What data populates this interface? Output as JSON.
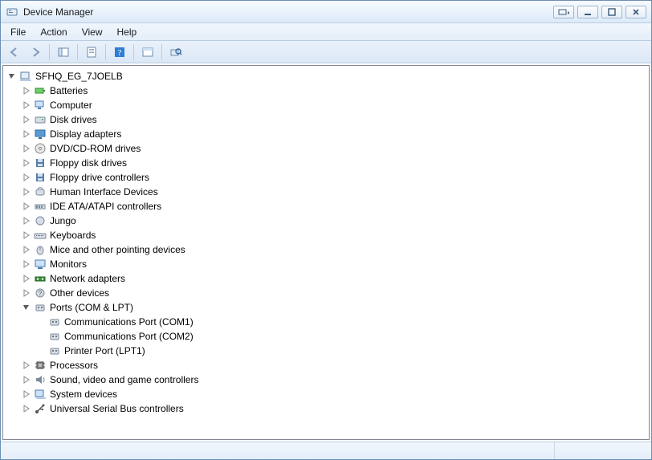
{
  "window": {
    "title": "Device Manager"
  },
  "menu": {
    "file": "File",
    "action": "Action",
    "view": "View",
    "help": "Help"
  },
  "tree": {
    "root": "SFHQ_EG_7JOELB",
    "categories": [
      {
        "label": "Batteries",
        "icon": "battery"
      },
      {
        "label": "Computer",
        "icon": "computer"
      },
      {
        "label": "Disk drives",
        "icon": "disk"
      },
      {
        "label": "Display adapters",
        "icon": "display"
      },
      {
        "label": "DVD/CD-ROM drives",
        "icon": "cd"
      },
      {
        "label": "Floppy disk drives",
        "icon": "floppy"
      },
      {
        "label": "Floppy drive controllers",
        "icon": "floppy"
      },
      {
        "label": "Human Interface Devices",
        "icon": "hid"
      },
      {
        "label": "IDE ATA/ATAPI controllers",
        "icon": "ide"
      },
      {
        "label": "Jungo",
        "icon": "generic"
      },
      {
        "label": "Keyboards",
        "icon": "keyboard"
      },
      {
        "label": "Mice and other pointing devices",
        "icon": "mouse"
      },
      {
        "label": "Monitors",
        "icon": "monitor"
      },
      {
        "label": "Network adapters",
        "icon": "network"
      },
      {
        "label": "Other devices",
        "icon": "other"
      },
      {
        "label": "Ports (COM & LPT)",
        "icon": "port",
        "expanded": true,
        "children": [
          {
            "label": "Communications Port (COM1)",
            "icon": "port"
          },
          {
            "label": "Communications Port (COM2)",
            "icon": "port"
          },
          {
            "label": "Printer Port (LPT1)",
            "icon": "port"
          }
        ]
      },
      {
        "label": "Processors",
        "icon": "cpu"
      },
      {
        "label": "Sound, video and game controllers",
        "icon": "sound"
      },
      {
        "label": "System devices",
        "icon": "system"
      },
      {
        "label": "Universal Serial Bus controllers",
        "icon": "usb"
      }
    ]
  }
}
